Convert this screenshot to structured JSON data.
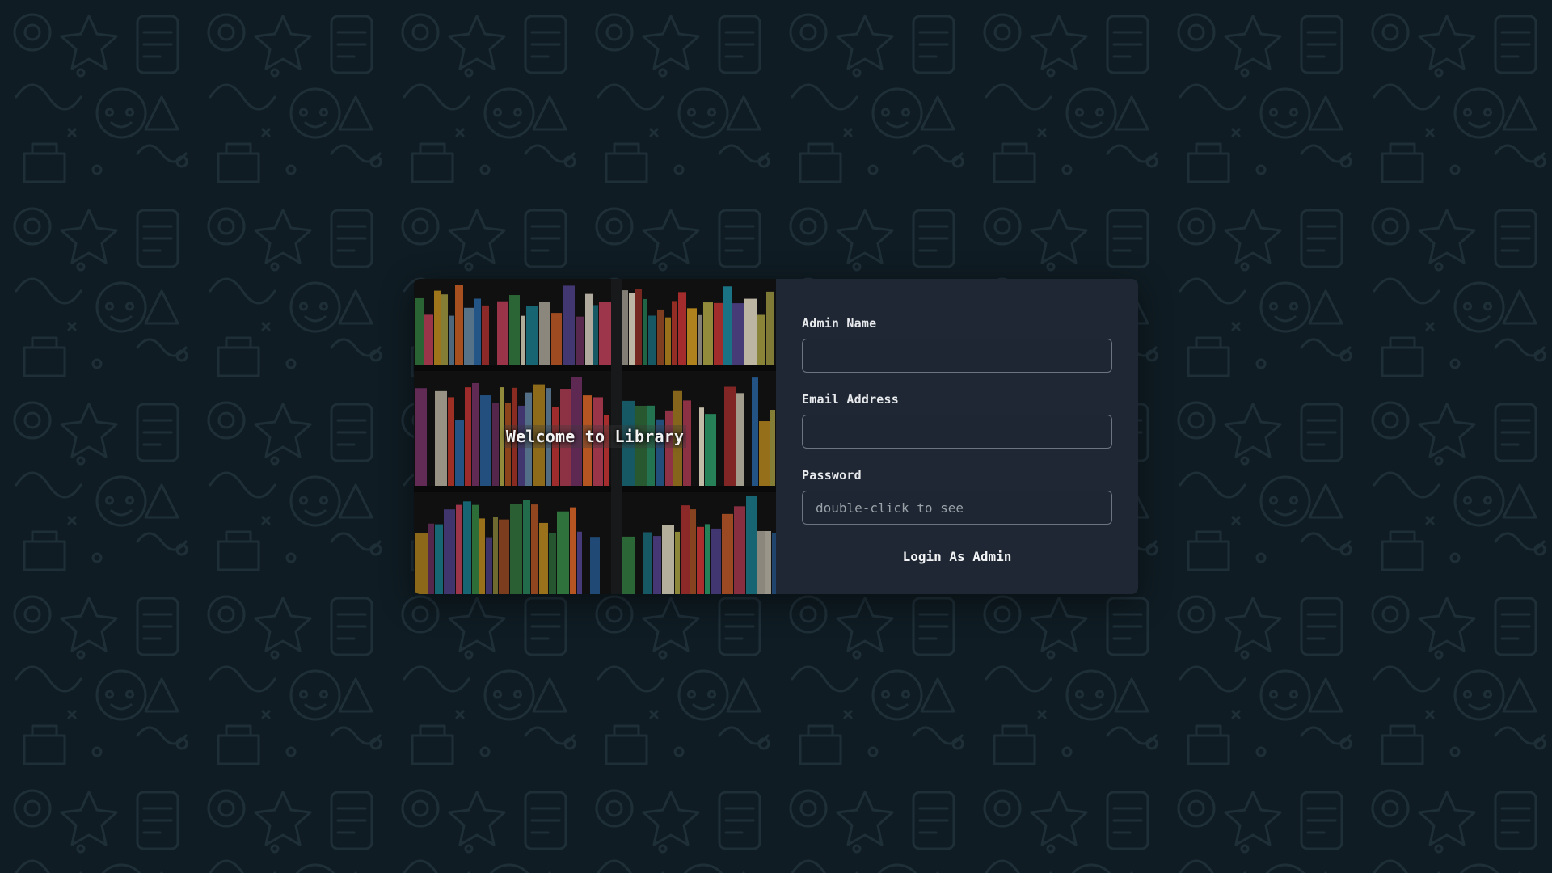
{
  "hero": {
    "title": "Welcome to Library",
    "image_description": "bookshelf photo",
    "book_colors": [
      "#c23b2e",
      "#e0a526",
      "#2e6fb0",
      "#3b8f4a",
      "#d9d2c2",
      "#8a3b7a",
      "#e86d2a",
      "#1f8fa3",
      "#b8b04a",
      "#e24b6a",
      "#f0e8d0",
      "#5a4a9a",
      "#c9602c",
      "#2f9e6d",
      "#d83a3a",
      "#7aa3c7"
    ]
  },
  "form": {
    "admin_name": {
      "label": "Admin Name",
      "value": "",
      "placeholder": ""
    },
    "email": {
      "label": "Email Address",
      "value": "",
      "placeholder": ""
    },
    "password": {
      "label": "Password",
      "value": "",
      "placeholder": "double-click to see"
    },
    "submit_label": "Login As Admin"
  },
  "colors": {
    "background": "#0f1c23",
    "doodle_stroke": "#1f2f38",
    "panel": "#1e2733",
    "input_border": "#6b7480",
    "text": "#e6e8ea"
  }
}
